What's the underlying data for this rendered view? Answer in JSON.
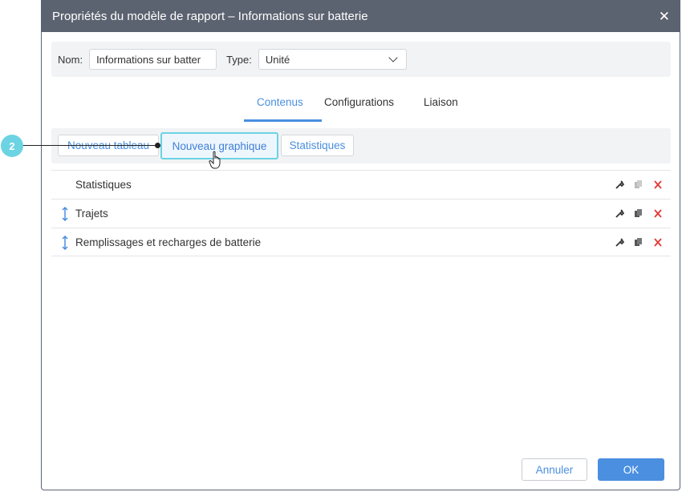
{
  "dialog": {
    "title": "Propriétés du modèle de rapport – Informations sur batterie",
    "close": "✕"
  },
  "form": {
    "name_label": "Nom:",
    "name_value": "Informations sur batter",
    "type_label": "Type:",
    "type_value": "Unité"
  },
  "tabs": [
    {
      "label": "Contenus",
      "active": true
    },
    {
      "label": "Configurations",
      "active": false
    },
    {
      "label": "Liaison",
      "active": false
    }
  ],
  "toolbar": {
    "new_table": "Nouveau tableau",
    "new_chart": "Nouveau graphique",
    "statistics": "Statistiques"
  },
  "items": [
    {
      "label": "Statistiques",
      "draggable": false
    },
    {
      "label": "Trajets",
      "draggable": true
    },
    {
      "label": "Remplissages et recharges de batterie",
      "draggable": true
    }
  ],
  "footer": {
    "cancel": "Annuler",
    "ok": "OK"
  },
  "callout": {
    "number": "2"
  },
  "colors": {
    "titlebar": "#5c6370",
    "accent": "#4a8fe0",
    "highlight": "#6cd3e3",
    "delete": "#e53935"
  }
}
